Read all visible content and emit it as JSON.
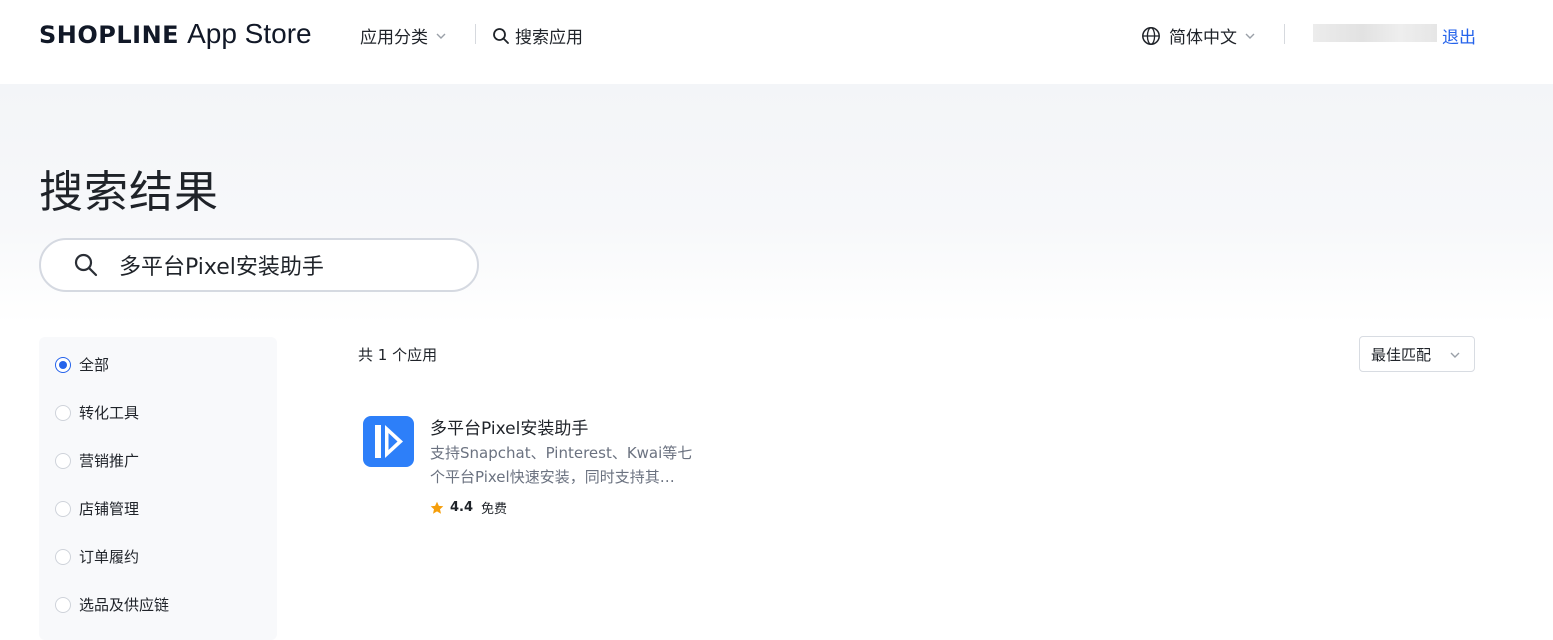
{
  "header": {
    "brand_name": "SHOPLINE",
    "brand_suffix": "App Store",
    "category_menu": "应用分类",
    "search_link": "搜索应用",
    "language": "简体中文",
    "logout": "退出"
  },
  "page": {
    "title": "搜索结果",
    "search_value": "多平台Pixel安装助手"
  },
  "filters": [
    {
      "label": "全部",
      "checked": true
    },
    {
      "label": "转化工具",
      "checked": false
    },
    {
      "label": "营销推广",
      "checked": false
    },
    {
      "label": "店铺管理",
      "checked": false
    },
    {
      "label": "订单履约",
      "checked": false
    },
    {
      "label": "选品及供应链",
      "checked": false
    }
  ],
  "results": {
    "count_text": "共 1 个应用",
    "sort_label": "最佳匹配",
    "apps": [
      {
        "name": "多平台Pixel安装助手",
        "description": "支持Snapchat、Pinterest、Kwai等七个平台Pixel快速安装，同时支持其…",
        "rating": "4.4",
        "price": "免费"
      }
    ]
  },
  "colors": {
    "accent": "#2563eb",
    "app_icon_bg": "#2d7ff9",
    "star": "#f59e0b"
  }
}
